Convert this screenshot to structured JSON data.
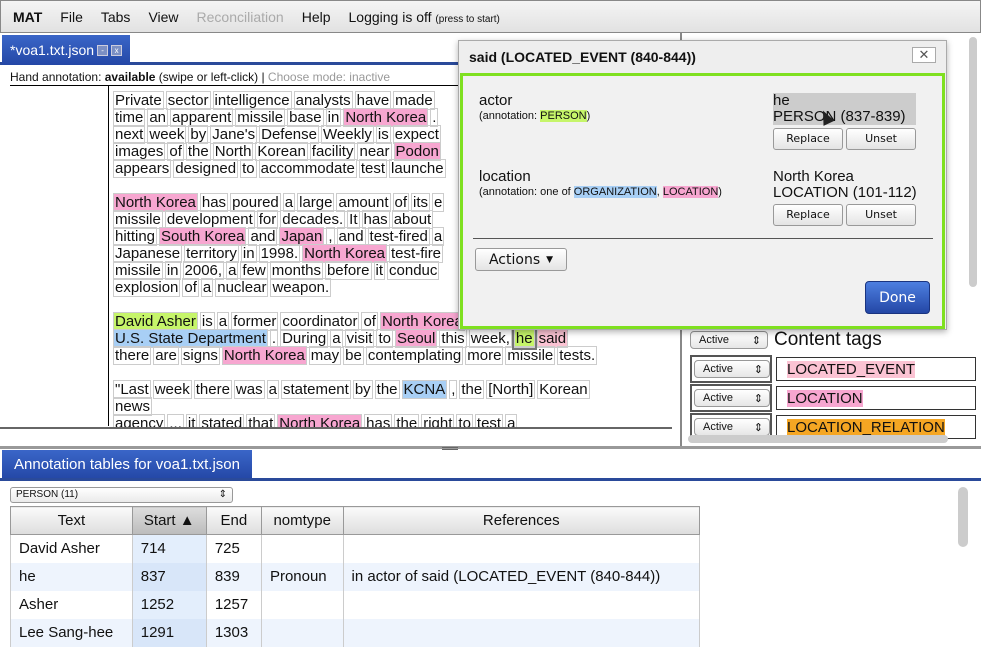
{
  "menu": {
    "brand": "MAT",
    "items": [
      "File",
      "Tabs",
      "View",
      "Reconciliation",
      "Help"
    ],
    "logging": "Logging is off",
    "logging_hint": "(press to start)"
  },
  "doc_tab": {
    "label": "*voa1.txt.json",
    "min": "-",
    "close": "x"
  },
  "hint": {
    "prefix": "Hand annotation: ",
    "status": "available",
    "suffix": " (swipe or left-click)  |  ",
    "choose": "Choose mode: inactive"
  },
  "document": {
    "lines": [
      [
        [
          "Private sector intelligence analysts have made",
          ""
        ]
      ],
      [
        [
          "time an apparent missile base in",
          ""
        ],
        [
          "North Korea",
          "loc"
        ],
        [
          ".",
          ""
        ]
      ],
      [
        [
          "next week by Jane's Defense Weekly is expect",
          ""
        ]
      ],
      [
        [
          "images of the North Korean facility near",
          ""
        ],
        [
          "Podon",
          "loc"
        ]
      ],
      [
        [
          "appears designed to accommodate test launche",
          ""
        ]
      ],
      [],
      [
        [
          "North Korea",
          "loc"
        ],
        [
          "has poured a large amount of its e",
          ""
        ]
      ],
      [
        [
          "missile development for decades. It has about",
          ""
        ]
      ],
      [
        [
          "hitting",
          ""
        ],
        [
          "South Korea",
          "loc"
        ],
        [
          "and",
          ""
        ],
        [
          "Japan",
          "loc"
        ],
        [
          ", and test-fired a",
          ""
        ]
      ],
      [
        [
          "Japanese territory in 1998.",
          ""
        ],
        [
          "North Korea",
          "loc"
        ],
        [
          "test-fire",
          ""
        ]
      ],
      [
        [
          "missile in 2006, a few months before it conduc",
          ""
        ]
      ],
      [
        [
          "explosion of a nuclear weapon.",
          ""
        ]
      ],
      [],
      [
        [
          "David Asher",
          "per"
        ],
        [
          "is a former coordinator of",
          ""
        ],
        [
          "North Korea",
          "loc"
        ]
      ],
      [
        [
          "U.S. State Department",
          "org"
        ],
        [
          ". During a visit to",
          ""
        ],
        [
          "Seoul",
          "loc"
        ],
        [
          "this week,",
          ""
        ],
        [
          "he",
          "per sel"
        ],
        [
          "said",
          "evt"
        ]
      ],
      [
        [
          "there are signs",
          ""
        ],
        [
          "North Korea",
          "loc"
        ],
        [
          "may be contemplating more missile tests.",
          ""
        ]
      ],
      [],
      [
        [
          "\"Last week there was a statement by the",
          ""
        ],
        [
          "KCNA",
          "org"
        ],
        [
          ", the [North] Korean",
          ""
        ]
      ],
      [
        [
          "news",
          ""
        ]
      ],
      [
        [
          "agency ... it stated that",
          ""
        ],
        [
          "North Korea",
          "loc"
        ],
        [
          "has the right to test a",
          ""
        ]
      ]
    ]
  },
  "dialog": {
    "title": "said (LOCATED_EVENT (840-844))",
    "close": "✕",
    "slots": [
      {
        "name": "actor",
        "prefix": "(annotation: ",
        "types": [
          {
            "label": "PERSON",
            "cls": "per"
          }
        ],
        "value_text": "he",
        "value_ann": "PERSON (837-839)"
      },
      {
        "name": "location",
        "prefix": "(annotation: one of ",
        "types": [
          {
            "label": "ORGANIZATION",
            "cls": "org"
          },
          {
            "label": "LOCATION",
            "cls": "loc"
          }
        ],
        "value_text": "North Korea",
        "value_ann": "LOCATION (101-112)"
      }
    ],
    "replace": "Replace",
    "unset": "Unset",
    "actions": "Actions",
    "done": "Done"
  },
  "right_panel": {
    "content_tags_label": "Content tags",
    "active": "Active",
    "tags": [
      {
        "label": "LOCATED_EVENT",
        "color": "#fbc3d3"
      },
      {
        "label": "LOCATION",
        "color": "#f7a6d0"
      },
      {
        "label": "LOCATION_RELATION",
        "color": "#f5a623"
      }
    ]
  },
  "bottom": {
    "tab": "Annotation tables for voa1.txt.json",
    "select": "PERSON (11)",
    "columns": [
      "Text",
      "Start ▲",
      "End",
      "nomtype",
      "References"
    ],
    "rows": [
      [
        "David Asher",
        "714",
        "725",
        "",
        ""
      ],
      [
        "he",
        "837",
        "839",
        "Pronoun",
        "in actor of said (LOCATED_EVENT (840-844))"
      ],
      [
        "Asher",
        "1252",
        "1257",
        "",
        ""
      ],
      [
        "Lee Sang-hee",
        "1291",
        "1303",
        "",
        ""
      ]
    ]
  }
}
